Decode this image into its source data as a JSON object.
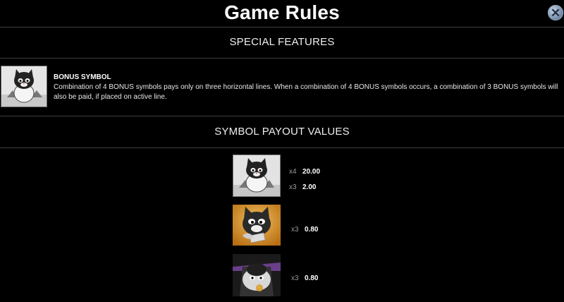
{
  "header": {
    "title": "Game Rules",
    "close_icon": "close-icon"
  },
  "special_features": {
    "heading": "SPECIAL FEATURES",
    "bonus": {
      "icon": "bonus-cat-symbol",
      "name": "BONUS SYMBOL",
      "description": "Combination of 4 BONUS symbols pays only on three horizontal lines. When a combination of 4 BONUS symbols occurs, a combination of 3 BONUS symbols will also be paid, if placed on active line."
    }
  },
  "payouts": {
    "heading": "SYMBOL PAYOUT VALUES",
    "symbols": [
      {
        "icon": "bonus-cat-symbol",
        "rows": [
          {
            "mult": "x4",
            "value": "20.00"
          },
          {
            "mult": "x3",
            "value": "2.00"
          }
        ]
      },
      {
        "icon": "cat-with-fish-symbol",
        "rows": [
          {
            "mult": "x3",
            "value": "0.80"
          }
        ]
      },
      {
        "icon": "cat-wizard-symbol",
        "rows": [
          {
            "mult": "x3",
            "value": "0.80"
          }
        ]
      }
    ]
  }
}
